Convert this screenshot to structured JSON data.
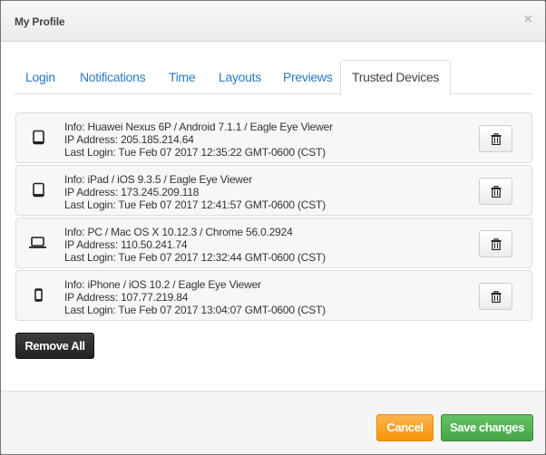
{
  "dialog": {
    "title": "My Profile",
    "close_icon": "×"
  },
  "tabs": [
    {
      "label": "Login",
      "active": false
    },
    {
      "label": "Notifications",
      "active": false
    },
    {
      "label": "Time",
      "active": false
    },
    {
      "label": "Layouts",
      "active": false
    },
    {
      "label": "Previews",
      "active": false
    },
    {
      "label": "Trusted Devices",
      "active": true
    }
  ],
  "devices": [
    {
      "icon": "tablet-icon",
      "info": "Info: Huawei Nexus 6P / Android 7.1.1 / Eagle Eye Viewer",
      "ip": "IP Address: 205.185.214.64",
      "last_login": "Last Login: Tue Feb 07 2017 12:35:22 GMT-0600 (CST)"
    },
    {
      "icon": "tablet-icon",
      "info": "Info: iPad / iOS 9.3.5 / Eagle Eye Viewer",
      "ip": "IP Address: 173.245.209.118",
      "last_login": "Last Login: Tue Feb 07 2017 12:41:57 GMT-0600 (CST)"
    },
    {
      "icon": "laptop-icon",
      "info": "Info: PC / Mac OS X 10.12.3 / Chrome 56.0.2924",
      "ip": "IP Address: 110.50.241.74",
      "last_login": "Last Login: Tue Feb 07 2017 12:32:44 GMT-0600 (CST)"
    },
    {
      "icon": "mobile-icon",
      "info": "Info: iPhone / iOS 10.2 / Eagle Eye Viewer",
      "ip": "IP Address: 107.77.219.84",
      "last_login": "Last Login: Tue Feb 07 2017 13:04:07 GMT-0600 (CST)"
    }
  ],
  "actions": {
    "remove_all": "Remove All",
    "cancel": "Cancel",
    "save": "Save changes"
  }
}
